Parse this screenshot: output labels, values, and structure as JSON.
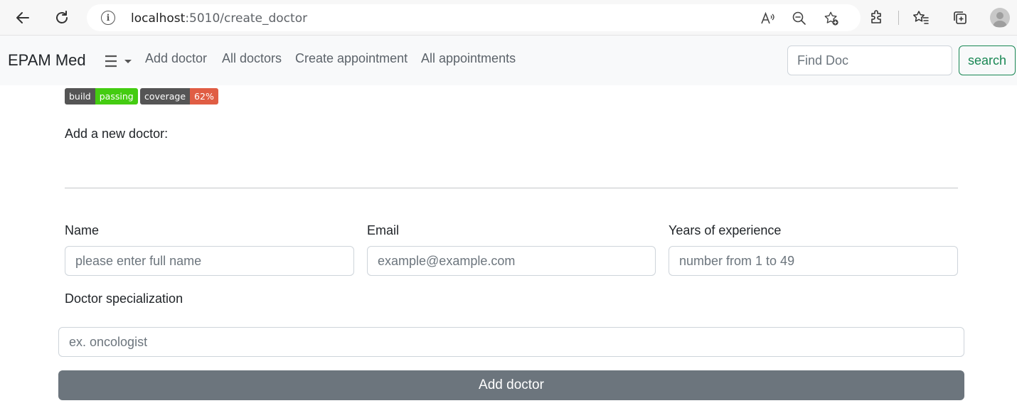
{
  "browser": {
    "url_host": "localhost",
    "url_path": ":5010/create_doctor"
  },
  "navbar": {
    "brand": "EPAM Med",
    "links": [
      "Add doctor",
      "All doctors",
      "Create appointment",
      "All appointments"
    ],
    "search_placeholder": "Find Doc",
    "search_button": "search"
  },
  "badges": [
    {
      "label": "build",
      "value": "passing",
      "color": "#44cc11"
    },
    {
      "label": "coverage",
      "value": "62%",
      "color": "#e05d44"
    }
  ],
  "form": {
    "title": "Add a new doctor:",
    "name_label": "Name",
    "name_placeholder": "please enter full name",
    "email_label": "Email",
    "email_placeholder": "example@example.com",
    "experience_label": "Years of experience",
    "experience_placeholder": "number from 1 to 49",
    "specialization_label": "Doctor specialization",
    "specialization_placeholder": "ex. oncologist",
    "submit_label": "Add doctor"
  },
  "colors": {
    "search_button": "#198754",
    "submit_button": "#6c757d",
    "navbar_bg": "#f8f9fa"
  }
}
